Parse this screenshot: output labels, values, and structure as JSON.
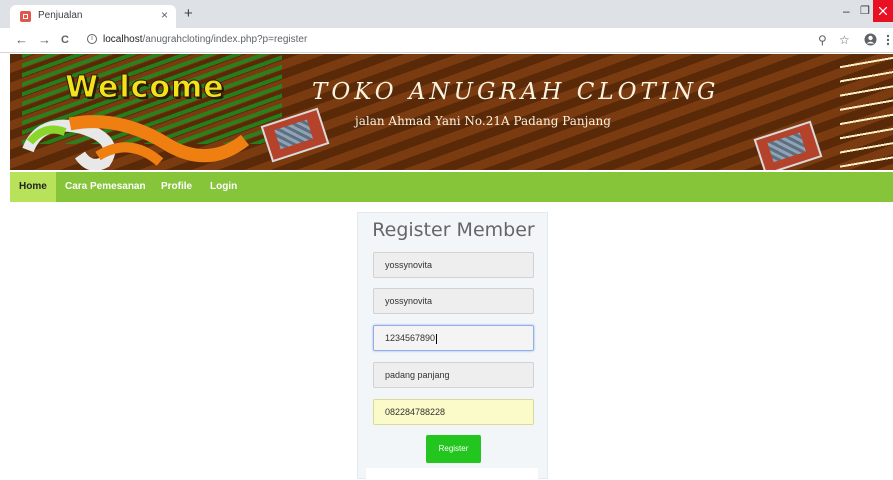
{
  "browser": {
    "tab_title": "Penjualan",
    "tab_close": "×",
    "new_tab": "+",
    "url_host": "localhost",
    "url_path": "/anugrahcloting/index.php?p=register",
    "back": "←",
    "forward": "→",
    "reload": "C",
    "zoom_icon": "⚲",
    "star_icon": "☆",
    "minimize": "–",
    "maximize": "❐"
  },
  "header": {
    "welcome_text": "Welcome",
    "shop_name": "TOKO ANUGRAH CLOTING",
    "shop_address": "jalan Ahmad Yani No.21A Padang Panjang"
  },
  "menu": [
    {
      "label": "Home",
      "active": true
    },
    {
      "label": "Cara Pemesanan",
      "active": false
    },
    {
      "label": "Profile",
      "active": false
    },
    {
      "label": "Login",
      "active": false
    }
  ],
  "register_form": {
    "title": "Register Member",
    "fields": [
      {
        "value": "yossynovita"
      },
      {
        "value": "yossynovita"
      },
      {
        "value": "1234567890"
      },
      {
        "value": "padang panjang"
      },
      {
        "value": "082284788228"
      }
    ],
    "submit_label": "Register"
  },
  "colors": {
    "menu_bar": "#86c43a",
    "menu_active": "#b7e25a",
    "register_button": "#22c61e",
    "banner_brown": "#5a2a08"
  }
}
